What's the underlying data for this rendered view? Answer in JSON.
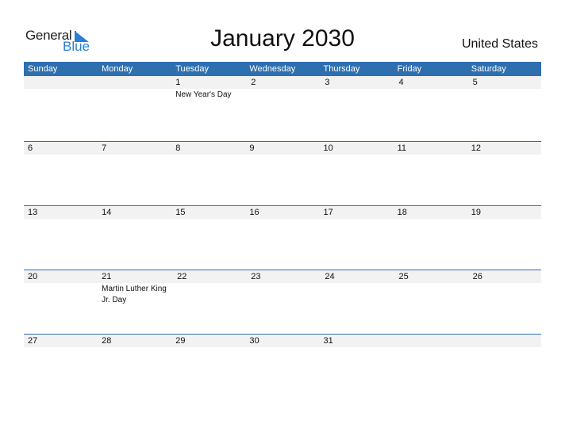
{
  "logo": {
    "text_general": "General",
    "text_blue": "Blue"
  },
  "title": "January 2030",
  "country": "United States",
  "colors": {
    "header_bg": "#2e6fb0",
    "date_band": "#f2f2f2",
    "logo_blue": "#2a7fd4"
  },
  "weekdays": [
    "Sunday",
    "Monday",
    "Tuesday",
    "Wednesday",
    "Thursday",
    "Friday",
    "Saturday"
  ],
  "weeks": [
    [
      {
        "d": ""
      },
      {
        "d": ""
      },
      {
        "d": "1",
        "h": "New Year's Day"
      },
      {
        "d": "2"
      },
      {
        "d": "3"
      },
      {
        "d": "4"
      },
      {
        "d": "5"
      }
    ],
    [
      {
        "d": "6"
      },
      {
        "d": "7"
      },
      {
        "d": "8"
      },
      {
        "d": "9"
      },
      {
        "d": "10"
      },
      {
        "d": "11"
      },
      {
        "d": "12"
      }
    ],
    [
      {
        "d": "13"
      },
      {
        "d": "14"
      },
      {
        "d": "15"
      },
      {
        "d": "16"
      },
      {
        "d": "17"
      },
      {
        "d": "18"
      },
      {
        "d": "19"
      }
    ],
    [
      {
        "d": "20"
      },
      {
        "d": "21",
        "h": "Martin Luther King Jr. Day"
      },
      {
        "d": "22"
      },
      {
        "d": "23"
      },
      {
        "d": "24"
      },
      {
        "d": "25"
      },
      {
        "d": "26"
      }
    ],
    [
      {
        "d": "27"
      },
      {
        "d": "28"
      },
      {
        "d": "29"
      },
      {
        "d": "30"
      },
      {
        "d": "31"
      },
      {
        "d": ""
      },
      {
        "d": ""
      }
    ]
  ]
}
